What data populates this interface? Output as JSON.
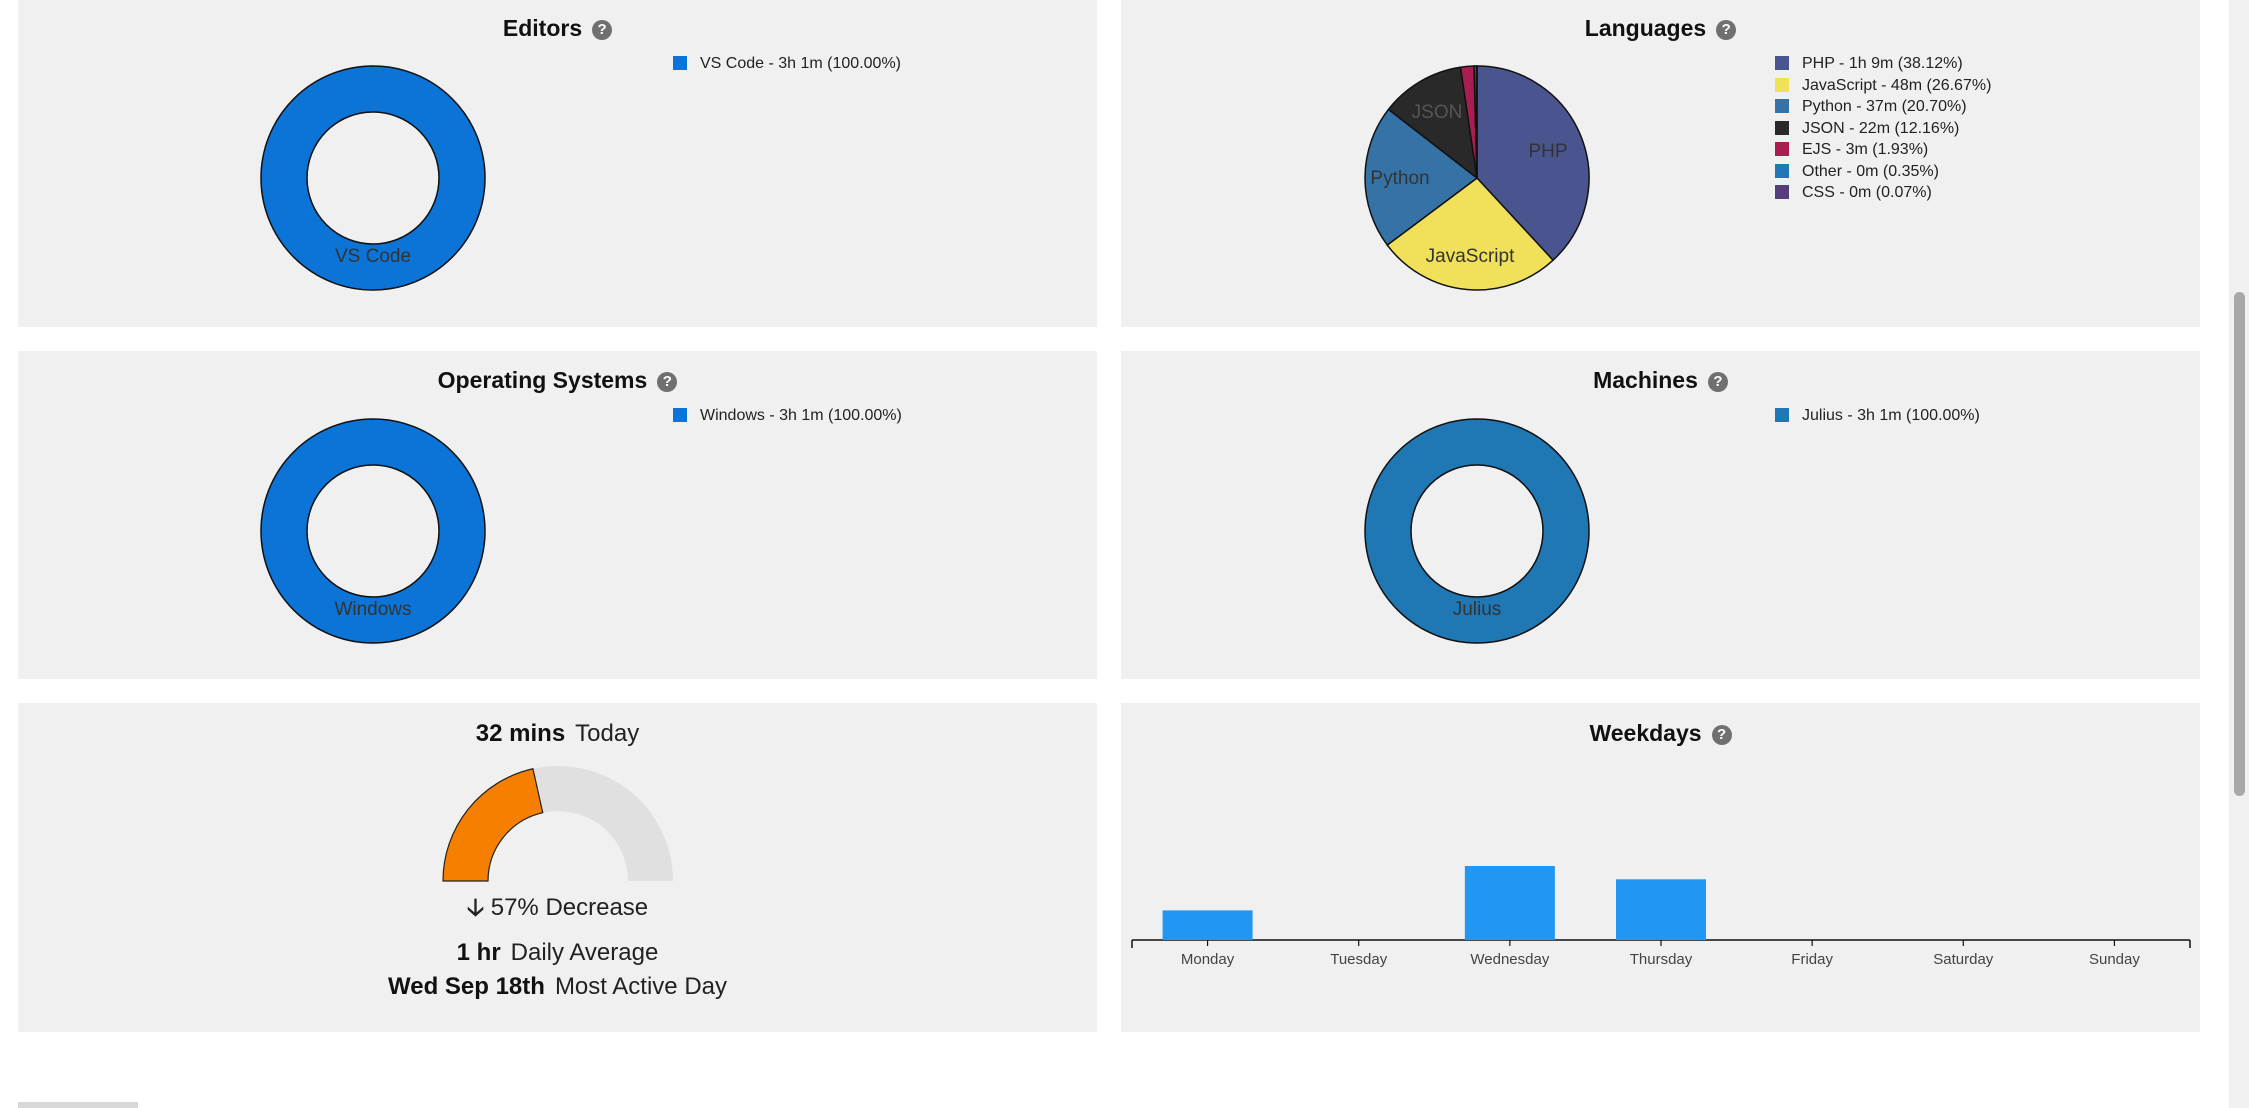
{
  "editors": {
    "title": "Editors",
    "legend": [
      {
        "label": "VS Code - 3h 1m (100.00%)",
        "color": "#0b74d6"
      }
    ],
    "ring_label": "VS Code"
  },
  "languages": {
    "title": "Languages",
    "legend": [
      {
        "label": "PHP - 1h 9m (38.12%)",
        "color": "#4a5590"
      },
      {
        "label": "JavaScript - 48m (26.67%)",
        "color": "#f1e05a"
      },
      {
        "label": "Python - 37m (20.70%)",
        "color": "#3572a5"
      },
      {
        "label": "JSON - 22m (12.16%)",
        "color": "#292929"
      },
      {
        "label": "EJS - 3m (1.93%)",
        "color": "#a91e50"
      },
      {
        "label": "Other - 0m (0.35%)",
        "color": "#1f77b4"
      },
      {
        "label": "CSS - 0m (0.07%)",
        "color": "#563d7c"
      }
    ],
    "slice_labels": {
      "php": "PHP",
      "javascript": "JavaScript",
      "python": "Python",
      "json": "JSON"
    }
  },
  "os": {
    "title": "Operating Systems",
    "legend": [
      {
        "label": "Windows - 3h 1m (100.00%)",
        "color": "#0b74d6"
      }
    ],
    "ring_label": "Windows"
  },
  "machines": {
    "title": "Machines",
    "legend": [
      {
        "label": "Julius - 3h 1m (100.00%)",
        "color": "#1f77b4"
      }
    ],
    "ring_label": "Julius"
  },
  "today": {
    "value": "32 mins",
    "label": "Today",
    "gauge_fraction": 0.43,
    "gauge_color": "#f77f00",
    "change_arrow": "🡣",
    "change": "57% Decrease",
    "daily_average_value": "1 hr",
    "daily_average_label": "Daily Average",
    "most_active_value": "Wed Sep 18th",
    "most_active_label": "Most Active Day"
  },
  "weekdays": {
    "title": "Weekdays",
    "bar_color": "#2196f3"
  },
  "help_icon": "?",
  "chart_data": [
    {
      "type": "pie",
      "title": "Editors",
      "categories": [
        "VS Code"
      ],
      "values": [
        100.0
      ]
    },
    {
      "type": "pie",
      "title": "Languages",
      "categories": [
        "PHP",
        "JavaScript",
        "Python",
        "JSON",
        "EJS",
        "Other",
        "CSS"
      ],
      "values": [
        38.12,
        26.67,
        20.7,
        12.16,
        1.93,
        0.35,
        0.07
      ]
    },
    {
      "type": "pie",
      "title": "Operating Systems",
      "categories": [
        "Windows"
      ],
      "values": [
        100.0
      ]
    },
    {
      "type": "pie",
      "title": "Machines",
      "categories": [
        "Julius"
      ],
      "values": [
        100.0
      ]
    },
    {
      "type": "bar",
      "title": "Weekdays",
      "categories": [
        "Monday",
        "Tuesday",
        "Wednesday",
        "Thursday",
        "Friday",
        "Saturday",
        "Sunday"
      ],
      "values": [
        0.4,
        0,
        1.0,
        0.82,
        0,
        0,
        0
      ],
      "ylabel": "",
      "grid": false,
      "legend": "none"
    }
  ]
}
